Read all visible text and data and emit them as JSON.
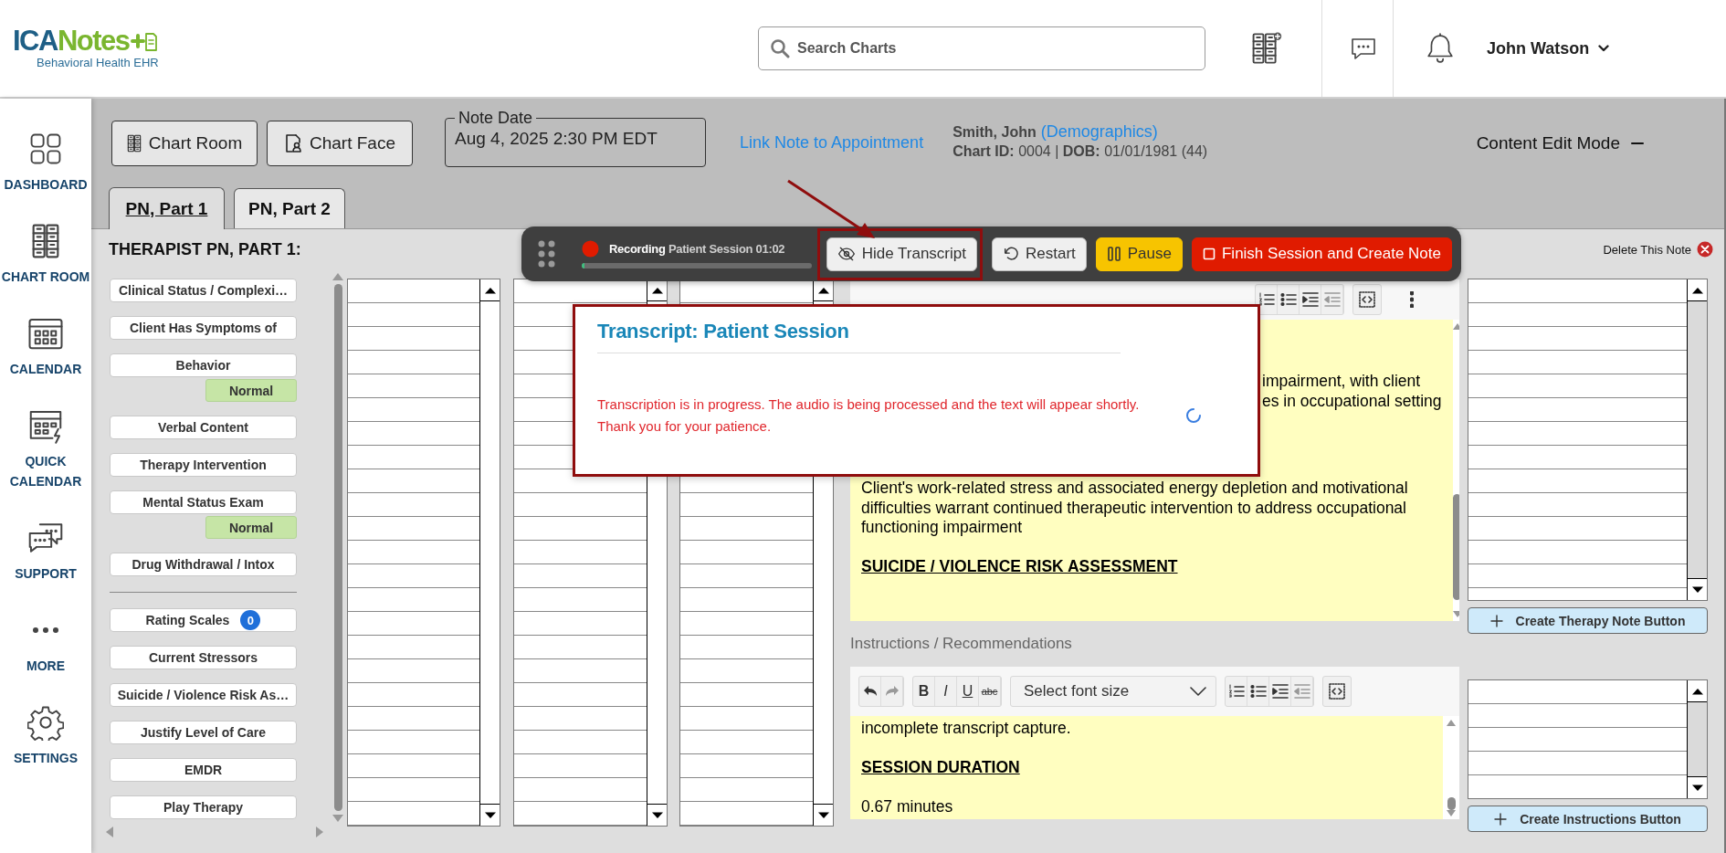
{
  "header": {
    "logo": {
      "name_first": "ICA",
      "name_second": "Notes",
      "tagline": "Behavioral Health EHR"
    },
    "search": {
      "placeholder": "Search Charts"
    },
    "user": {
      "name": "John Watson"
    }
  },
  "nav": [
    {
      "kind": "dashboard",
      "label": "DASHBOARD"
    },
    {
      "kind": "chart_room",
      "label": "CHART ROOM"
    },
    {
      "kind": "calendar",
      "label": "CALENDAR"
    },
    {
      "kind": "quick_calendar",
      "label": "QUICK CALENDAR"
    },
    {
      "kind": "support",
      "label": "SUPPORT"
    },
    {
      "kind": "more",
      "label": "MORE"
    },
    {
      "kind": "settings",
      "label": "SETTINGS"
    }
  ],
  "toolbar": {
    "buttons": [
      {
        "kind": "chart_room",
        "label": "Chart Room"
      },
      {
        "kind": "chart_face",
        "label": "Chart Face"
      }
    ],
    "note_date": {
      "label": "Note Date",
      "value": "Aug 4, 2025 2:30 PM EDT"
    },
    "appointment_link": "Link Note to Appointment",
    "patient": {
      "name": "Smith, John",
      "demographics_link": "(Demographics)",
      "details": "**Chart ID:** 0004 | **DOB:** 01/01/1981 (44)"
    },
    "mode": "Content Edit Mode"
  },
  "tabs": [
    {
      "label": "PN, Part 1",
      "selected": true
    },
    {
      "label": "PN, Part 2",
      "selected": false
    }
  ],
  "note": {
    "title": "THERAPIST PN, PART 1:",
    "delete_label": "Delete This Note",
    "sections": [
      [
        {
          "label": "Clinical Status / Complexi…"
        },
        {
          "label": "Client Has Symptoms of"
        },
        {
          "label": "Behavior",
          "badge": {
            "kind": "status",
            "text": "Normal"
          }
        },
        {
          "label": "Verbal Content"
        },
        {
          "label": "Therapy Intervention"
        },
        {
          "label": "Mental Status Exam",
          "badge": {
            "kind": "status",
            "text": "Normal"
          }
        },
        {
          "label": "Drug Withdrawal / Intox"
        }
      ],
      [
        {
          "label": "Rating Scales",
          "badge": {
            "kind": "count",
            "text": "0"
          }
        },
        {
          "label": "Current Stressors"
        },
        {
          "label": "Suicide / Violence Risk As…"
        },
        {
          "label": "Justify Level of Care"
        },
        {
          "label": "EMDR"
        },
        {
          "label": "Play Therapy"
        }
      ]
    ]
  },
  "editors": [
    {
      "paragraphs": [
        {
          "kind": "fragment",
          "text": "impairment, with client"
        },
        {
          "kind": "fragment",
          "text": "es in occupational setting"
        },
        {
          "kind": "text",
          "text": "Client's work-related stress and associated energy depletion and motivational difficulties warrant continued therapeutic intervention to address occupational functioning impairment",
          "space_before": false
        },
        {
          "kind": "heading",
          "text": "SUICIDE / VIOLENCE RISK ASSESSMENT",
          "space_before": true
        }
      ],
      "side_button": "Create Therapy Note Button"
    },
    {
      "label": "Instructions / Recommendations",
      "toolbar": {
        "formats": [
          {
            "kind": "bold",
            "text": "B"
          },
          {
            "kind": "italic",
            "text": "I"
          },
          {
            "kind": "underline",
            "text": "U"
          },
          {
            "kind": "strike",
            "text": "abc"
          }
        ],
        "font_size_placeholder": "Select font size"
      },
      "paragraphs": [
        {
          "kind": "text",
          "text": "incomplete transcript capture.",
          "space_before": false
        },
        {
          "kind": "heading",
          "text": "SESSION DURATION",
          "space_before": true
        },
        {
          "kind": "text",
          "text": "0.67 minutes",
          "space_before": true
        }
      ],
      "side_button": "Create Instructions Button"
    }
  ],
  "recording": {
    "status": "Recording",
    "session": "Patient Session 01:02",
    "level": 0.01,
    "buttons": [
      {
        "kind": "transcript",
        "label": "Hide Transcript",
        "highlighted": true
      },
      {
        "kind": "restart",
        "label": "Restart",
        "highlighted": false
      },
      {
        "kind": "pause",
        "label": "Pause",
        "highlighted": false
      },
      {
        "kind": "finish",
        "label": "Finish Session and Create Note",
        "highlighted": false
      }
    ]
  },
  "transcript": {
    "title": "Transcript: Patient Session",
    "message": "Transcription is in progress. The audio is being processed and the text will appear shortly. Thank you for your patience.",
    "highlighted": true
  }
}
